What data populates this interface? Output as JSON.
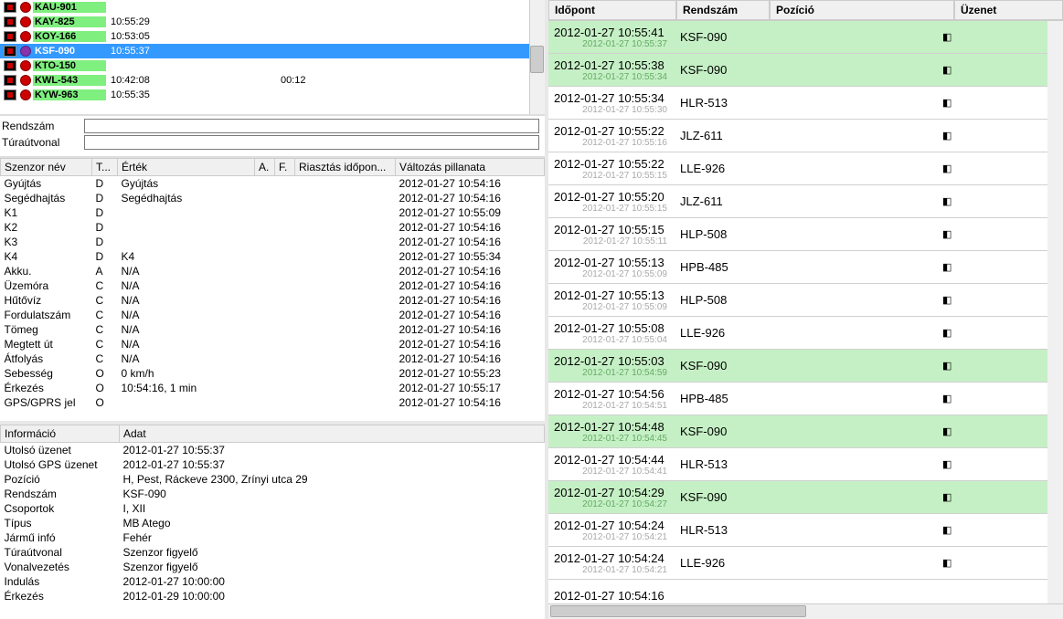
{
  "vehicles": [
    {
      "plate": "KAU-901",
      "time": "",
      "dot": "red"
    },
    {
      "plate": "KAY-825",
      "time": "10:55:29",
      "dot": "red"
    },
    {
      "plate": "KOY-166",
      "time": "10:53:05",
      "dot": "red"
    },
    {
      "plate": "KSF-090",
      "time": "10:55:37",
      "dot": "purple",
      "selected": true
    },
    {
      "plate": "KTO-150",
      "time": "",
      "dot": "red"
    },
    {
      "plate": "KWL-543",
      "time": "10:42:08",
      "dur": "00:12",
      "dot": "red"
    },
    {
      "plate": "KYW-963",
      "time": "10:55:35",
      "dot": "red"
    }
  ],
  "form": {
    "rendszam_label": "Rendszám",
    "turautvonal_label": "Túraútvonal"
  },
  "sensor_headers": {
    "name": "Szenzor név",
    "t": "T...",
    "value": "Érték",
    "a": "A.",
    "f": "F.",
    "alarm": "Riasztás időpon...",
    "change": "Változás pillanata"
  },
  "sensors": [
    {
      "name": "Gyújtás",
      "t": "D",
      "value": "Gyújtás",
      "change": "2012-01-27 10:54:16"
    },
    {
      "name": "Segédhajtás",
      "t": "D",
      "value": "Segédhajtás",
      "change": "2012-01-27 10:54:16"
    },
    {
      "name": "K1",
      "t": "D",
      "value": "",
      "change": "2012-01-27 10:55:09"
    },
    {
      "name": "K2",
      "t": "D",
      "value": "",
      "change": "2012-01-27 10:54:16"
    },
    {
      "name": "K3",
      "t": "D",
      "value": "",
      "change": "2012-01-27 10:54:16"
    },
    {
      "name": "K4",
      "t": "D",
      "value": "K4",
      "change": "2012-01-27 10:55:34"
    },
    {
      "name": "Akku.",
      "t": "A",
      "value": "N/A",
      "change": "2012-01-27 10:54:16"
    },
    {
      "name": "Üzemóra",
      "t": "C",
      "value": "N/A",
      "change": "2012-01-27 10:54:16"
    },
    {
      "name": "Hűtővíz",
      "t": "C",
      "value": "N/A",
      "change": "2012-01-27 10:54:16"
    },
    {
      "name": "Fordulatszám",
      "t": "C",
      "value": "N/A",
      "change": "2012-01-27 10:54:16"
    },
    {
      "name": "Tömeg",
      "t": "C",
      "value": "N/A",
      "change": "2012-01-27 10:54:16"
    },
    {
      "name": "Megtett út",
      "t": "C",
      "value": "N/A",
      "change": "2012-01-27 10:54:16"
    },
    {
      "name": "Átfolyás",
      "t": "C",
      "value": "N/A",
      "change": "2012-01-27 10:54:16"
    },
    {
      "name": "Sebesség",
      "t": "O",
      "value": "0 km/h",
      "change": "2012-01-27 10:55:23"
    },
    {
      "name": "Érkezés",
      "t": "O",
      "value": "10:54:16, 1 min",
      "change": "2012-01-27 10:55:17"
    },
    {
      "name": "GPS/GPRS jel",
      "t": "O",
      "value": "",
      "change": "2012-01-27 10:54:16"
    }
  ],
  "info_headers": {
    "info": "Információ",
    "data": "Adat"
  },
  "info": [
    {
      "k": "Utolsó üzenet",
      "v": "2012-01-27 10:55:37"
    },
    {
      "k": "Utolsó GPS üzenet",
      "v": "2012-01-27 10:55:37"
    },
    {
      "k": "Pozíció",
      "v": "H, Pest, Ráckeve 2300, Zrínyi utca 29"
    },
    {
      "k": "Rendszám",
      "v": "KSF-090"
    },
    {
      "k": "Csoportok",
      "v": "I, XII"
    },
    {
      "k": "Típus",
      "v": "MB Atego"
    },
    {
      "k": "Jármű infó",
      "v": "Fehér"
    },
    {
      "k": "Túraútvonal",
      "v": "Szenzor figyelő"
    },
    {
      "k": "Vonalvezetés",
      "v": "Szenzor figyelő"
    },
    {
      "k": "Indulás",
      "v": "2012-01-27 10:00:00"
    },
    {
      "k": "Érkezés",
      "v": "2012-01-29 10:00:00"
    }
  ],
  "right_headers": {
    "time": "Időpont",
    "plate": "Rendszám",
    "pos": "Pozíció",
    "msg": "Üzenet"
  },
  "messages": [
    {
      "time": "2012-01-27 10:55:41",
      "sub": "2012-01-27 10:55:37",
      "plate": "KSF-090",
      "msg": "◧",
      "hl": true
    },
    {
      "time": "2012-01-27 10:55:38",
      "sub": "2012-01-27 10:55:34",
      "plate": "KSF-090",
      "msg": "◧",
      "hl": true
    },
    {
      "time": "2012-01-27 10:55:34",
      "sub": "2012-01-27 10:55:30",
      "plate": "HLR-513",
      "msg": "◧",
      "hl": false
    },
    {
      "time": "2012-01-27 10:55:22",
      "sub": "2012-01-27 10:55:16",
      "plate": "JLZ-611",
      "msg": "◧",
      "hl": false
    },
    {
      "time": "2012-01-27 10:55:22",
      "sub": "2012-01-27 10:55:15",
      "plate": "LLE-926",
      "msg": "◧",
      "hl": false
    },
    {
      "time": "2012-01-27 10:55:20",
      "sub": "2012-01-27 10:55:15",
      "plate": "JLZ-611",
      "msg": "◧",
      "hl": false
    },
    {
      "time": "2012-01-27 10:55:15",
      "sub": "2012-01-27 10:55:11",
      "plate": "HLP-508",
      "msg": "◧",
      "hl": false
    },
    {
      "time": "2012-01-27 10:55:13",
      "sub": "2012-01-27 10:55:09",
      "plate": "HPB-485",
      "msg": "◧",
      "hl": false
    },
    {
      "time": "2012-01-27 10:55:13",
      "sub": "2012-01-27 10:55:09",
      "plate": "HLP-508",
      "msg": "◧",
      "hl": false
    },
    {
      "time": "2012-01-27 10:55:08",
      "sub": "2012-01-27 10:55:04",
      "plate": "LLE-926",
      "msg": "◧",
      "hl": false
    },
    {
      "time": "2012-01-27 10:55:03",
      "sub": "2012-01-27 10:54:59",
      "plate": "KSF-090",
      "msg": "◧",
      "hl": true
    },
    {
      "time": "2012-01-27 10:54:56",
      "sub": "2012-01-27 10:54:51",
      "plate": "HPB-485",
      "msg": "◧",
      "hl": false
    },
    {
      "time": "2012-01-27 10:54:48",
      "sub": "2012-01-27 10:54:45",
      "plate": "KSF-090",
      "msg": "◧",
      "hl": true
    },
    {
      "time": "2012-01-27 10:54:44",
      "sub": "2012-01-27 10:54:41",
      "plate": "HLR-513",
      "msg": "◧",
      "hl": false
    },
    {
      "time": "2012-01-27 10:54:29",
      "sub": "2012-01-27 10:54:27",
      "plate": "KSF-090",
      "msg": "◧",
      "hl": true
    },
    {
      "time": "2012-01-27 10:54:24",
      "sub": "2012-01-27 10:54:21",
      "plate": "HLR-513",
      "msg": "◧",
      "hl": false
    },
    {
      "time": "2012-01-27 10:54:24",
      "sub": "2012-01-27 10:54:21",
      "plate": "LLE-926",
      "msg": "◧",
      "hl": false
    },
    {
      "time": "2012-01-27 10:54:16",
      "sub": "",
      "plate": "",
      "msg": "",
      "hl": false
    }
  ]
}
